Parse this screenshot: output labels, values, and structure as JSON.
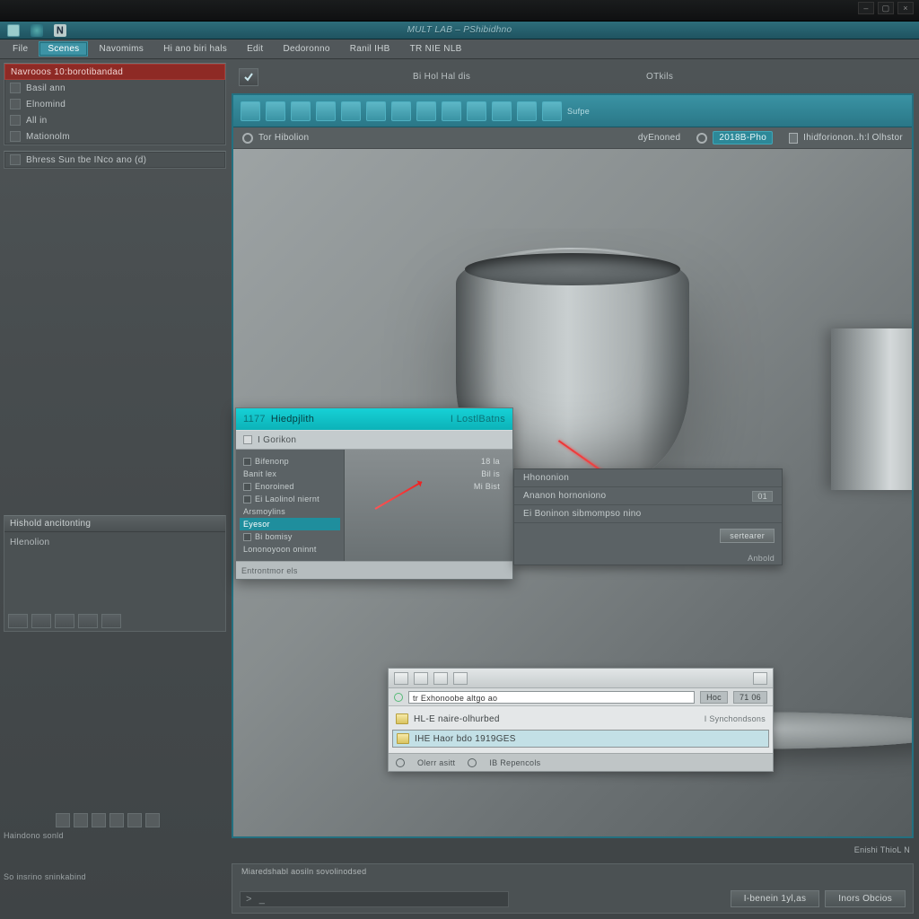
{
  "titlebar": {
    "min": "–",
    "max": "▢",
    "close": "×"
  },
  "topstrip": {
    "title": "MULT LAB – PShibidhno"
  },
  "menu": {
    "items": [
      "File",
      "Scenes",
      "Navomims",
      "Hi ano biri hals",
      "Edit",
      "Dedoronno",
      "Ranil IHB",
      "TR NIE NLB"
    ],
    "active": 1
  },
  "subbar": {
    "center": "Bi Hol Hal dis",
    "right": "OTkils"
  },
  "left": {
    "panel1_hdr": "Navrooos 10:borotibandad",
    "panel1_rows": [
      "Basil ann",
      "Elnomind",
      "All in",
      "Mationolm"
    ],
    "panel2_row": "Bhress Sun tbe INco ano (d)",
    "hist_hdr": "Hishold ancitonting",
    "hist_sub": "Hlenolion",
    "lower": "Haindono sonld",
    "status": "So insrino sninkabind"
  },
  "viewport": {
    "info_left": "Tor Hibolion",
    "info_mid": "dyEnoned",
    "info_pill": "2018B-Pho",
    "info_right": "Ihidforionon..h:l Olhstor"
  },
  "dialog": {
    "num": "1177",
    "title": "Hiedpjlith",
    "right": "I LostlBatns",
    "section": "I Gorikon",
    "tree": [
      "Bifenonp",
      "Banit lex",
      "Enoroined",
      "Ei Laolinol niernt",
      "Arsmoylins",
      "Eyesor",
      "Bi bomisy",
      "Lononoyoon oninnt"
    ],
    "tree_sel": 5,
    "mini": [
      "18 la",
      "Bil is",
      "Mi Bist"
    ],
    "footer": "Entrontmor els"
  },
  "dark2": {
    "rows": [
      {
        "t": "Hhononion",
        "b": ""
      },
      {
        "t": "Ananon hornoniono",
        "b": "01"
      },
      {
        "t": "Ei Boninon  sibmompso nino",
        "b": ""
      }
    ],
    "tag": "Anbold",
    "btn": "sertearer"
  },
  "fbrowse": {
    "path_label": "tr Exhonoobe  altgo ao",
    "chip1": "Hoc",
    "chip2": "71 06",
    "items": [
      {
        "name": "HL-E  naire-olhurbed",
        "meta": "I Synchondsons"
      },
      {
        "name": "IHE   Haor bdo 1919GES",
        "meta": ""
      }
    ],
    "stat1": "Olerr asitt",
    "stat2": "IB  Repencols"
  },
  "brb": "Enishi ThioL N",
  "bottom": {
    "line1": "Miaredshabl aosiln sovolinodsed",
    "btn1": "I-benein 1yl,as",
    "btn2": "Inors Obcios"
  }
}
